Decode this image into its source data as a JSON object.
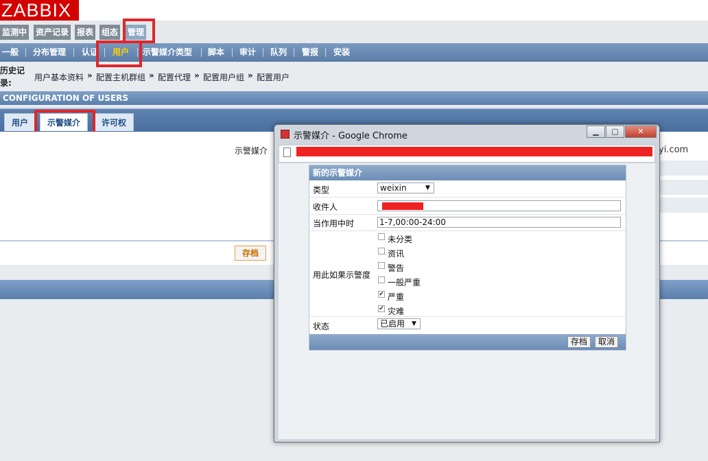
{
  "logo": "ZABBIX",
  "main_menu": [
    "监测中",
    "资产记录",
    "报表",
    "组态",
    "管理"
  ],
  "sub_menu": [
    "一般",
    "分布管理",
    "认证",
    "用户",
    "示警媒介类型",
    "脚本",
    "审计",
    "队列",
    "警报",
    "安装"
  ],
  "history": {
    "label": "历史记录:",
    "crumbs": [
      "用户基本资料",
      "配置主机群组",
      "配置代理",
      "配置用户组",
      "配置用户"
    ],
    "arrow": "»"
  },
  "section_title": "CONFIGURATION OF USERS",
  "tabs": [
    "用户",
    "示警媒介",
    "许可权"
  ],
  "content": {
    "media_label": "示警媒介",
    "media_tail": "yi.com",
    "save": "存档"
  },
  "popup": {
    "title": "示警媒介 - Google Chrome",
    "window_buttons": [
      "▁",
      "▢",
      "✕"
    ],
    "form_title": "新的示警媒介",
    "fields": {
      "type_label": "类型",
      "type_value": "weixin",
      "recipient_label": "收件人",
      "recipient_value": "",
      "active_label": "当作用中时",
      "active_value": "1-7,00:00-24:00",
      "severity_label": "用此如果示警度",
      "status_label": "状态",
      "status_value": "已启用"
    },
    "severities": [
      {
        "label": "未分类",
        "checked": false
      },
      {
        "label": "资讯",
        "checked": false
      },
      {
        "label": "警告",
        "checked": false
      },
      {
        "label": "一般严重",
        "checked": false
      },
      {
        "label": "严重",
        "checked": true
      },
      {
        "label": "灾难",
        "checked": true
      }
    ],
    "buttons": {
      "save": "存档",
      "cancel": "取消"
    },
    "caret": "▼"
  }
}
